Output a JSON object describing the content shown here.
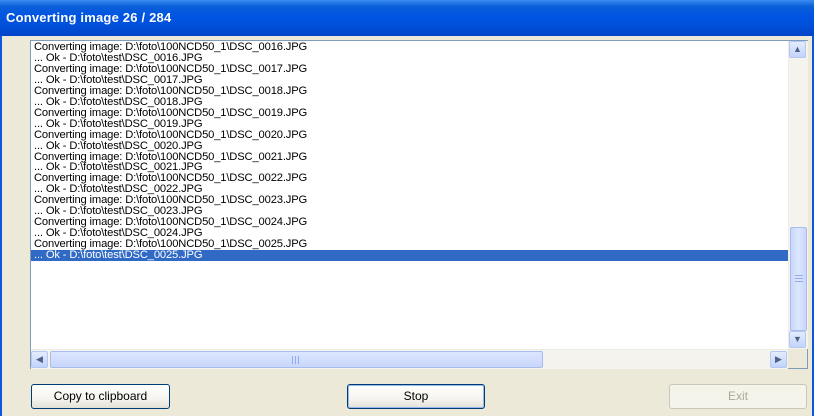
{
  "window": {
    "title": "Converting image 26 / 284"
  },
  "log": {
    "lines": [
      "Converting image: D:\\foto\\100NCD50_1\\DSC_0016.JPG",
      "... Ok - D:\\foto\\test\\DSC_0016.JPG",
      "Converting image: D:\\foto\\100NCD50_1\\DSC_0017.JPG",
      "... Ok - D:\\foto\\test\\DSC_0017.JPG",
      "Converting image: D:\\foto\\100NCD50_1\\DSC_0018.JPG",
      "... Ok - D:\\foto\\test\\DSC_0018.JPG",
      "Converting image: D:\\foto\\100NCD50_1\\DSC_0019.JPG",
      "... Ok - D:\\foto\\test\\DSC_0019.JPG",
      "Converting image: D:\\foto\\100NCD50_1\\DSC_0020.JPG",
      "... Ok - D:\\foto\\test\\DSC_0020.JPG",
      "Converting image: D:\\foto\\100NCD50_1\\DSC_0021.JPG",
      "... Ok - D:\\foto\\test\\DSC_0021.JPG",
      "Converting image: D:\\foto\\100NCD50_1\\DSC_0022.JPG",
      "... Ok - D:\\foto\\test\\DSC_0022.JPG",
      "Converting image: D:\\foto\\100NCD50_1\\DSC_0023.JPG",
      "... Ok - D:\\foto\\test\\DSC_0023.JPG",
      "Converting image: D:\\foto\\100NCD50_1\\DSC_0024.JPG",
      "... Ok - D:\\foto\\test\\DSC_0024.JPG",
      "Converting image: D:\\foto\\100NCD50_1\\DSC_0025.JPG",
      "... Ok - D:\\foto\\test\\DSC_0025.JPG"
    ],
    "selected_index": 19
  },
  "buttons": {
    "copy_label": "Copy to clipboard",
    "stop_label": "Stop",
    "exit_label": "Exit"
  },
  "icons": {
    "scroll_up": "scroll-up-arrow-icon",
    "scroll_down": "scroll-down-arrow-icon",
    "scroll_left": "scroll-left-arrow-icon",
    "scroll_right": "scroll-right-arrow-icon"
  },
  "colors": {
    "title_bar": "#0054e3",
    "selection": "#316ac5"
  }
}
